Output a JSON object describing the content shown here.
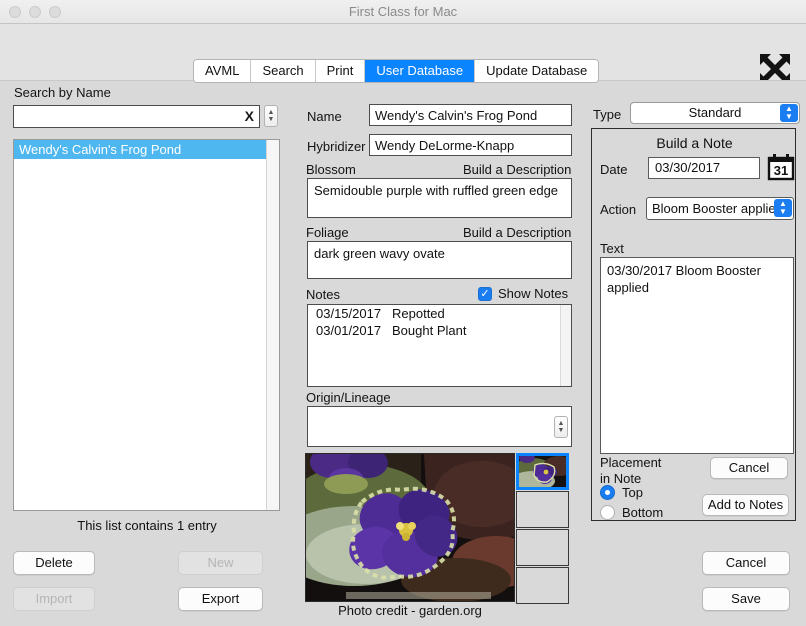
{
  "window": {
    "title": "First Class for Mac",
    "traffic_lights": [
      "close",
      "minimize",
      "zoom"
    ],
    "move_icon": "move-resize-icon"
  },
  "tabs": [
    {
      "label": "AVML",
      "active": false
    },
    {
      "label": "Search",
      "active": false
    },
    {
      "label": "Print",
      "active": false
    },
    {
      "label": "User Database",
      "active": true
    },
    {
      "label": "Update Database",
      "active": false
    }
  ],
  "left": {
    "search_label": "Search by Name",
    "search_value": "",
    "search_placeholder": "",
    "clear_glyph": "X",
    "list_items": [
      {
        "label": "Wendy's Calvin's Frog Pond",
        "selected": true
      }
    ],
    "count_text": "This list contains 1 entry",
    "buttons": {
      "delete": "Delete",
      "new": "New",
      "import": "Import",
      "export": "Export"
    }
  },
  "center": {
    "name_label": "Name",
    "name_value": "Wendy's Calvin's Frog Pond",
    "hybridizer_label": "Hybridizer",
    "hybridizer_value": "Wendy DeLorme-Knapp",
    "blossom_label": "Blossom",
    "blossom_build": "Build a Description",
    "blossom_value": "Semidouble purple with ruffled green edge",
    "foliage_label": "Foliage",
    "foliage_build": "Build a Description",
    "foliage_value": "dark green wavy ovate",
    "notes_label": "Notes",
    "show_notes_label": "Show Notes",
    "show_notes_checked": true,
    "check_glyph": "✓",
    "notes": [
      {
        "date": "03/15/2017",
        "text": "Repotted"
      },
      {
        "date": "03/01/2017",
        "text": "Bought Plant"
      }
    ],
    "origin_label": "Origin/Lineage",
    "origin_value": "",
    "photo_credit": "Photo credit - garden.org",
    "thumbnails": [
      {
        "name": "thumbnail-1",
        "selected": true,
        "filled": true
      },
      {
        "name": "thumbnail-2",
        "selected": false,
        "filled": false
      },
      {
        "name": "thumbnail-3",
        "selected": false,
        "filled": false
      },
      {
        "name": "thumbnail-4",
        "selected": false,
        "filled": false
      }
    ]
  },
  "right": {
    "type_label": "Type",
    "type_value": "Standard",
    "note_panel_title": "Build a Note",
    "date_label": "Date",
    "date_value": "03/30/2017",
    "calendar_day": "31",
    "action_label": "Action",
    "action_value": "Bloom Booster applied",
    "text_label": "Text",
    "text_value": "03/30/2017   Bloom Booster applied",
    "placement_line1": "Placement",
    "placement_line2": "in Note",
    "placement_options": [
      {
        "label": "Top",
        "selected": true
      },
      {
        "label": "Bottom",
        "selected": false
      }
    ],
    "cancel_note_label": "Cancel",
    "add_to_notes_label": "Add to Notes",
    "cancel_label": "Cancel",
    "save_label": "Save"
  },
  "colors": {
    "accent": "#0b84ff",
    "selection": "#4fb7f0",
    "control_blue": "#1a7ef2",
    "window_bg": "#d9d9d9"
  }
}
